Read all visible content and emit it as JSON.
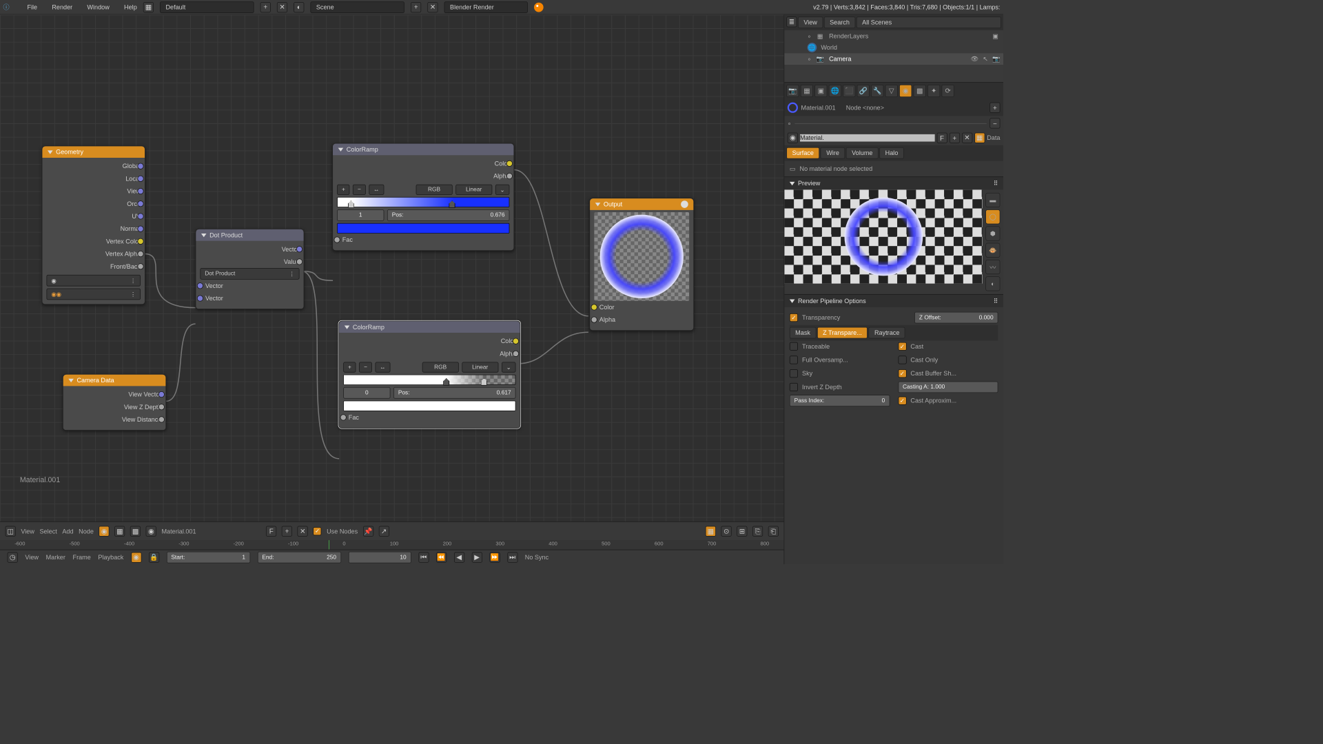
{
  "topbar": {
    "menus": [
      "File",
      "Render",
      "Window",
      "Help"
    ],
    "layout": "Default",
    "scene": "Scene",
    "engine": "Blender Render",
    "stats": "v2.79 | Verts:3,842 | Faces:3,840 | Tris:7,680 | Objects:1/1 | Lamps:"
  },
  "nodes": {
    "geometry": {
      "title": "Geometry",
      "outs": [
        "Global",
        "Local",
        "View",
        "Orco",
        "UV",
        "Normal",
        "Vertex Color",
        "Vertex Alpha",
        "Front/Back"
      ]
    },
    "camera": {
      "title": "Camera Data",
      "outs": [
        "View Vector",
        "View Z Depth",
        "View Distance"
      ]
    },
    "dot": {
      "title": "Dot Product",
      "mode": "Dot Product",
      "out_vec": "Vector",
      "out_val": "Value",
      "in1": "Vector",
      "in2": "Vector"
    },
    "ramp1": {
      "title": "ColorRamp",
      "outs": [
        "Color",
        "Alpha"
      ],
      "in": "Fac",
      "mode_a": "RGB",
      "mode_b": "Linear",
      "idx": "1",
      "pos": "Pos:",
      "posv": "0.676"
    },
    "ramp2": {
      "title": "ColorRamp",
      "outs": [
        "Color",
        "Alpha"
      ],
      "in": "Fac",
      "mode_a": "RGB",
      "mode_b": "Linear",
      "idx": "0",
      "pos": "Pos:",
      "posv": "0.617"
    },
    "output": {
      "title": "Output",
      "ins": [
        "Color",
        "Alpha"
      ]
    }
  },
  "outliner": {
    "tabs": [
      "View",
      "Search",
      "All Scenes"
    ],
    "items": [
      "RenderLayers",
      "World",
      "Camera"
    ]
  },
  "properties": {
    "material_name": "Material.001",
    "node_sel": "Node <none>",
    "matfield": "Material.",
    "f": "F",
    "data": "Data",
    "tabs": [
      "Surface",
      "Wire",
      "Volume",
      "Halo"
    ],
    "no_node": "No material node selected",
    "preview": "Preview",
    "pipeline_hdr": "Render Pipeline Options",
    "transparency": "Transparency",
    "zoffset_l": "Z Offset:",
    "zoffset_v": "0.000",
    "ztabs": [
      "Mask",
      "Z Transpare...",
      "Raytrace"
    ],
    "opts_l": [
      "Traceable",
      "Full Oversamp...",
      "Sky",
      "Invert Z Depth",
      "Pass Index:"
    ],
    "opts_r": [
      "Cast",
      "Cast Only",
      "Cast Buffer Sh...",
      "Casting A: 1.000",
      "Cast Approxim..."
    ],
    "pass_idx": "0"
  },
  "bottombar": {
    "menus": [
      "View",
      "Select",
      "Add",
      "Node"
    ],
    "material": "Material.001",
    "f": "F",
    "use_nodes": "Use Nodes"
  },
  "timeline": {
    "ticks": [
      "-600",
      "-500",
      "-400",
      "-300",
      "-200",
      "-100",
      "0",
      "100",
      "200",
      "300",
      "400",
      "500",
      "600",
      "700",
      "800"
    ],
    "menus": [
      "View",
      "Marker",
      "Frame",
      "Playback"
    ],
    "start_l": "Start:",
    "start_v": "1",
    "end_l": "End:",
    "end_v": "250",
    "cur": "10",
    "sync": "No Sync"
  },
  "material_label": "Material.001"
}
